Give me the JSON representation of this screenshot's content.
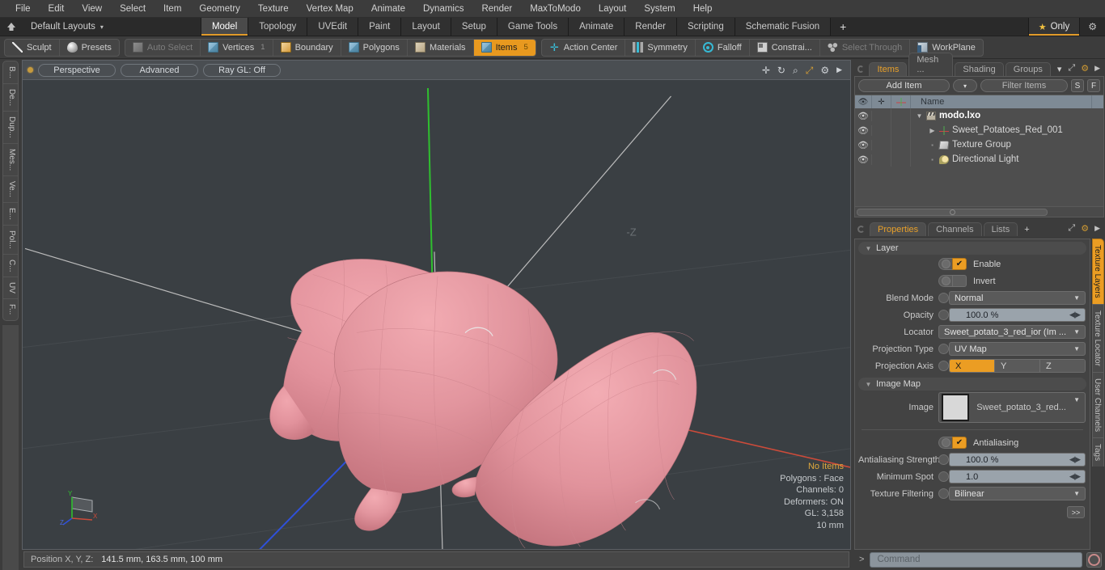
{
  "menubar": {
    "items": [
      "File",
      "Edit",
      "View",
      "Select",
      "Item",
      "Geometry",
      "Texture",
      "Vertex Map",
      "Animate",
      "Dynamics",
      "Render",
      "MaxToModo",
      "Layout",
      "System",
      "Help"
    ]
  },
  "layoutbar": {
    "home_icon": "home-icon",
    "layouts_label": "Default Layouts",
    "caret": "▾",
    "tabs": [
      {
        "label": "Model",
        "active": true
      },
      {
        "label": "Topology",
        "active": false
      },
      {
        "label": "UVEdit",
        "active": false
      },
      {
        "label": "Paint",
        "active": false
      },
      {
        "label": "Layout",
        "active": false
      },
      {
        "label": "Setup",
        "active": false
      },
      {
        "label": "Game Tools",
        "active": false
      },
      {
        "label": "Animate",
        "active": false
      },
      {
        "label": "Render",
        "active": false
      },
      {
        "label": "Scripting",
        "active": false
      },
      {
        "label": "Schematic Fusion",
        "active": false
      }
    ],
    "plus": "+",
    "only_label": "Only",
    "star": "★",
    "gear": "⚙",
    "accent": "#e29b2a"
  },
  "toolbar": {
    "group1": [
      {
        "label": "Sculpt",
        "icon": "pencil-icon",
        "state": "normal"
      },
      {
        "label": "Presets",
        "icon": "egg-icon",
        "state": "normal"
      }
    ],
    "group2": [
      {
        "label": "Auto Select",
        "icon": "cube-grey-icon",
        "state": "disabled",
        "num": ""
      },
      {
        "label": "Vertices",
        "icon": "cube-blue-icon",
        "state": "normal",
        "num": "1"
      },
      {
        "label": "Boundary",
        "icon": "cube-orange-icon",
        "state": "normal",
        "num": ""
      },
      {
        "label": "Polygons",
        "icon": "cube-blue-icon",
        "state": "normal",
        "num": ""
      },
      {
        "label": "Materials",
        "icon": "cube-tan-icon",
        "state": "normal",
        "num": ""
      },
      {
        "label": "Items",
        "icon": "cube-blue-icon",
        "state": "selected",
        "num": "5"
      }
    ],
    "group3": [
      {
        "label": "Action Center",
        "icon": "crosshair-icon",
        "state": "normal"
      },
      {
        "label": "Symmetry",
        "icon": "bars-icon",
        "state": "normal"
      },
      {
        "label": "Falloff",
        "icon": "target-icon",
        "state": "normal"
      },
      {
        "label": "Constrai...",
        "icon": "square-icon",
        "state": "normal"
      },
      {
        "label": "Select Through",
        "icon": "mesh-icon",
        "state": "disabled"
      },
      {
        "label": "WorkPlane",
        "icon": "workplane-icon",
        "state": "normal"
      }
    ]
  },
  "left_strip": {
    "tabs": [
      "B...",
      "De...",
      "Dup...",
      "Mes...",
      "Ve...",
      "E...",
      "Pol...",
      "C...",
      "UV",
      "F..."
    ]
  },
  "viewport": {
    "header": {
      "view_mode": "Perspective",
      "shading": "Advanced",
      "raygl": "Ray GL: Off",
      "icons": [
        "move-icon",
        "rotate-icon",
        "zoom-icon",
        "fit-icon",
        "gear-icon",
        "play-icon"
      ]
    },
    "stats": {
      "selection": "No Items",
      "polygons": "Polygons : Face",
      "channels": "Channels: 0",
      "deformers": "Deformers: ON",
      "gl": "GL: 3,158",
      "grid": "10 mm"
    },
    "scene": {
      "object_color": "#e08f99",
      "background": "#3a3f43",
      "axis_x_color": "#cc4b3a",
      "axis_y_color": "#2fbf2f",
      "axis_z_color": "#2f50d8",
      "objects": [
        "sweet-potato-1",
        "sweet-potato-2",
        "sweet-potato-3"
      ]
    },
    "gizmo_labels": {
      "x": "X",
      "y": "Y",
      "z": "Z"
    }
  },
  "statusbar": {
    "position_label": "Position X, Y, Z:",
    "position_value": "141.5 mm, 163.5 mm, 100 mm"
  },
  "right_panel": {
    "top_tabs": [
      {
        "label": "Items",
        "active": true
      },
      {
        "label": "Mesh ...",
        "active": false
      },
      {
        "label": "Shading",
        "active": false
      },
      {
        "label": "Groups",
        "active": false
      }
    ],
    "top_tabs_caret": "▾",
    "top_tab_icons": [
      "expand-icon",
      "gear-icon",
      "play-icon"
    ],
    "item_bar": {
      "add_item": "Add Item",
      "add_caret": "▾",
      "filter_placeholder": "Filter Items",
      "btn_s": "S",
      "btn_f": "F"
    },
    "list_header": {
      "eye": "👁",
      "lock": "✛",
      "axis": "axis-icon",
      "name": "Name"
    },
    "list_rows": [
      {
        "name": "modo.lxo",
        "icon": "clapboard-icon",
        "depth": 0,
        "root": true,
        "tri": "▼",
        "eye": "👁"
      },
      {
        "name": "Sweet_Potatoes_Red_001",
        "icon": "axis-icon",
        "depth": 1,
        "root": false,
        "tri": "▶",
        "eye": "👁"
      },
      {
        "name": "Texture Group",
        "icon": "folder-icon",
        "depth": 1,
        "root": false,
        "tri": "▪",
        "eye": "👁"
      },
      {
        "name": "Directional Light",
        "icon": "light-icon",
        "depth": 1,
        "root": false,
        "tri": "▪",
        "eye": "👁"
      }
    ],
    "prop_tabs": [
      {
        "label": "Properties",
        "active": true
      },
      {
        "label": "Channels",
        "active": false
      },
      {
        "label": "Lists",
        "active": false
      },
      {
        "label": "+",
        "active": false
      }
    ],
    "prop_tab_icons": [
      "expand-icon",
      "gear-icon",
      "play-icon"
    ],
    "layer_section": {
      "title": "Layer",
      "enable": {
        "label": "Enable",
        "checked": true,
        "mark": "✔"
      },
      "invert": {
        "label": "Invert",
        "checked": false,
        "mark": ""
      },
      "blend_mode": {
        "label": "Blend Mode",
        "value": "Normal"
      },
      "opacity": {
        "label": "Opacity",
        "value": "100.0 %"
      },
      "locator": {
        "label": "Locator",
        "value": "Sweet_potato_3_red_ior (Im ..."
      },
      "projection_type": {
        "label": "Projection Type",
        "value": "UV Map"
      },
      "projection_axis": {
        "label": "Projection Axis",
        "options": [
          "X",
          "Y",
          "Z"
        ],
        "selected": "X"
      }
    },
    "image_map_section": {
      "title": "Image Map",
      "image": {
        "label": "Image",
        "value": "Sweet_potato_3_red..."
      },
      "antialiasing": {
        "label": "Antialiasing",
        "checked": true,
        "mark": "✔"
      },
      "aa_strength": {
        "label": "Antialiasing Strength",
        "value": "100.0 %"
      },
      "minimum_spot": {
        "label": "Minimum Spot",
        "value": "1.0"
      },
      "texture_filtering": {
        "label": "Texture Filtering",
        "value": "Bilinear"
      },
      "more_button": ">>"
    },
    "side_tabs": [
      {
        "label": "Texture Layers",
        "active": true
      },
      {
        "label": "Texture Locator",
        "active": false
      },
      {
        "label": "User Channels",
        "active": false
      },
      {
        "label": "Tags",
        "active": false
      }
    ]
  },
  "command_bar": {
    "arrow": ">",
    "placeholder": "Command",
    "record_icon": "record-icon"
  }
}
